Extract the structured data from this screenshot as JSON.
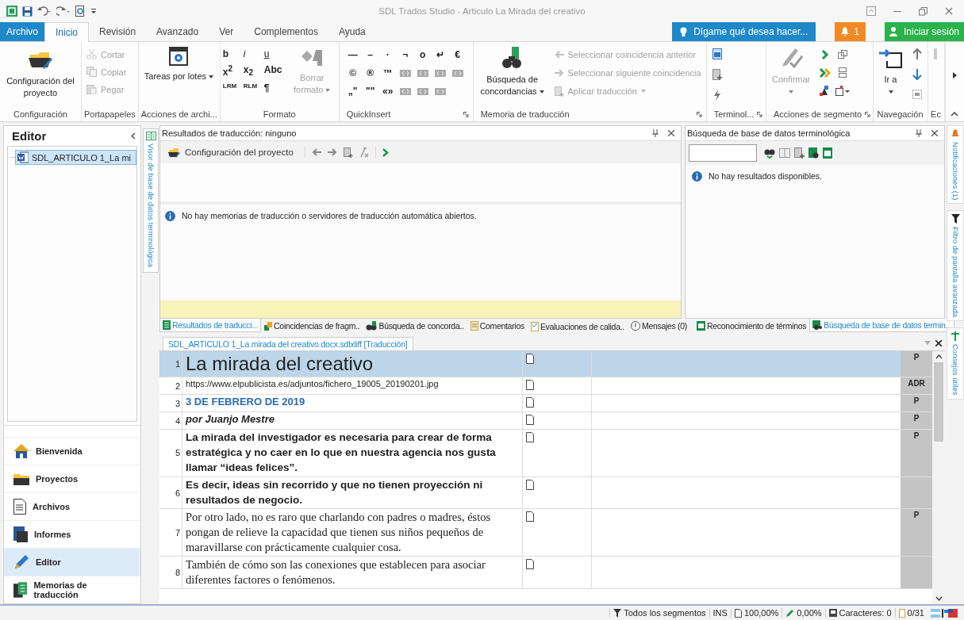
{
  "title_bar": {
    "title": "SDL Trados Studio - Articulo La Mirada del creativo"
  },
  "ribbon_tabs": [
    {
      "label": "Archivo",
      "kind": "file",
      "selected": false
    },
    {
      "label": "Inicio",
      "kind": "tab",
      "selected": true
    },
    {
      "label": "Revisión",
      "kind": "tab",
      "selected": false
    },
    {
      "label": "Avanzado",
      "kind": "tab",
      "selected": false
    },
    {
      "label": "Ver",
      "kind": "tab",
      "selected": false
    },
    {
      "label": "Complementos",
      "kind": "tab",
      "selected": false
    },
    {
      "label": "Ayuda",
      "kind": "tab",
      "selected": false
    }
  ],
  "tell_me": "Dígame qué desea hacer...",
  "alerts_count": "1",
  "sign_in": "Iniciar sesión",
  "ribbon_groups": [
    {
      "kind": "config",
      "name": "Configuración",
      "items": [
        {
          "label": "Configuración del proyecto",
          "disabled": false
        }
      ]
    },
    {
      "kind": "clipboard",
      "name": "Portapapeles",
      "items": [
        {
          "label": "Cortar",
          "disabled": true
        },
        {
          "label": "Copiar",
          "disabled": true
        },
        {
          "label": "Pegar",
          "disabled": true
        }
      ]
    },
    {
      "kind": "batch",
      "name": "Acciones de archi...",
      "items": [
        {
          "label": "Tareas por lotes",
          "disabled": false,
          "dropdown": true
        }
      ]
    },
    {
      "kind": "format",
      "name": "Formato",
      "glyphs": [
        "b",
        "i",
        "u",
        "x$^{2}$",
        "x$_{2}$",
        "Abc",
        "LRM",
        "RLM",
        "¶"
      ],
      "items": [
        {
          "label": "Borrar formato",
          "disabled": true,
          "dropdown": true
        }
      ]
    },
    {
      "kind": "quickinsert",
      "name": "QuickInsert",
      "rows": [
        [
          {
            "kind": "char",
            "text": "—"
          },
          {
            "kind": "char",
            "text": "–"
          },
          {
            "kind": "char",
            "text": "·"
          },
          {
            "kind": "char",
            "text": "¬"
          },
          {
            "kind": "char",
            "text": "o"
          },
          {
            "kind": "char",
            "text": "↵"
          },
          {
            "kind": "char",
            "text": "€"
          }
        ],
        [
          {
            "kind": "char",
            "text": "©"
          },
          {
            "kind": "char",
            "text": "®"
          },
          {
            "kind": "char",
            "text": "™"
          },
          {
            "kind": "tag"
          },
          {
            "kind": "tag"
          },
          {
            "kind": "tag"
          },
          {
            "kind": "tag"
          }
        ],
        [
          {
            "kind": "char",
            "text": "„\""
          },
          {
            "kind": "char",
            "text": "\"\""
          },
          {
            "kind": "char",
            "text": "«»"
          },
          {
            "kind": "tag"
          },
          {
            "kind": "tag"
          },
          {
            "kind": "tag"
          }
        ]
      ]
    },
    {
      "kind": "tm",
      "name": "Memoria de traducción",
      "items": [
        {
          "label": "Búsqueda de concordancias",
          "disabled": false,
          "dropdown": true
        },
        {
          "label": "Seleccionar coincidencia anterior",
          "disabled": true
        },
        {
          "label": "Seleccionar siguiente coincidencia",
          "disabled": true
        },
        {
          "label": "Aplicar traducción",
          "disabled": true,
          "dropdown": true
        }
      ]
    },
    {
      "kind": "termbase",
      "name": "Terminol..."
    },
    {
      "kind": "segment",
      "name": "Acciones de segmento",
      "items": [
        {
          "label": "Confirmar",
          "disabled": true,
          "dropdown": true
        }
      ]
    },
    {
      "kind": "nav",
      "name": "Navegación",
      "items": [
        {
          "label": "Ir a",
          "disabled": false,
          "dropdown": true
        }
      ]
    },
    {
      "kind": "cut",
      "name": "Ec"
    }
  ],
  "editor_panel": {
    "title": "Editor",
    "tree": [
      {
        "label": "SDL_ARTICULO 1_La mi",
        "selected": true
      }
    ]
  },
  "nav_items": [
    {
      "label": "Bienvenida",
      "selected": false
    },
    {
      "label": "Proyectos",
      "selected": false
    },
    {
      "label": "Archivos",
      "selected": false
    },
    {
      "label": "Informes",
      "selected": false
    },
    {
      "label": "Editor",
      "selected": true
    },
    {
      "label": "Memorias de traducción",
      "selected": false
    }
  ],
  "termbase_viewer_tab": "Visor de base de datos terminológica",
  "results_panel": {
    "title": "Resultados de traducción: ninguno",
    "toolbar_label": "Configuración del proyecto",
    "message": "No hay memorias de traducción o servidores de traducción automática abiertos."
  },
  "termbase_panel": {
    "title": "Búsqueda de base de datos terminológica",
    "message": "No hay resultados disponibles."
  },
  "bottom_tabs": [
    {
      "label": "Resultados de traducci...",
      "selected": true
    },
    {
      "label": "Coincidencias de fragm..",
      "selected": false
    },
    {
      "label": "Búsqueda de concorda..",
      "selected": false
    },
    {
      "label": "Comentarios",
      "selected": false
    },
    {
      "label": "Evaluaciones de calida..",
      "selected": false
    },
    {
      "label": "Mensajes (0)",
      "selected": false
    }
  ],
  "termbase_tabs": [
    {
      "label": "Reconocimiento de términos",
      "selected": false
    },
    {
      "label": "Búsqueda de base de datos termin...",
      "selected": true
    }
  ],
  "side_tabs": [
    "Notificaciones (1)",
    "Filtro de pantalla avanzada",
    "Consejos útiles"
  ],
  "document_tab": "SDL_ARTICULO 1_La mirada del creativo.docx.sdlxliff [Traducción]",
  "segments": [
    {
      "number": "1",
      "source": "La mirada del creativo",
      "kind": "heading",
      "status": "P",
      "selected": true
    },
    {
      "number": "2",
      "source": "https://www.elpublicista.es/adjuntos/fichero_19005_20190201.jpg",
      "kind": "plain",
      "status": "ADR",
      "selected": false
    },
    {
      "number": "3",
      "source": "3 DE FEBRERO DE 2019",
      "kind": "date",
      "status": "P",
      "selected": false
    },
    {
      "number": "4",
      "source": "por Juanjo Mestre",
      "kind": "byline",
      "status": "P",
      "selected": false
    },
    {
      "number": "5",
      "source": "La mirada del investigador es necesaria para crear de forma estratégica y no caer en lo que en nuestra agencia nos gusta llamar “ideas felices”.",
      "kind": "bold",
      "status": "P",
      "selected": false
    },
    {
      "number": "6",
      "source": "Es decir, ideas sin recorrido y que no tienen proyección ni resultados de negocio.",
      "kind": "bold",
      "selected": false
    },
    {
      "number": "7",
      "source": "Por otro lado, no es raro que charlando con padres o madres, éstos pongan de relieve la capacidad que tienen sus niños pequeños de maravillarse con prácticamente cualquier cosa.",
      "kind": "serif",
      "status": "P",
      "selected": false
    },
    {
      "number": "8",
      "source": "También de cómo son las conexiones que establecen para asociar diferentes factores o fenómenos.",
      "kind": "serif",
      "selected": false
    }
  ],
  "status_bar": {
    "filter": "Todos los segmentos",
    "mode": "INS",
    "match": "100,00%",
    "edited": "0,00%",
    "characters": "Caracteres: 0",
    "progress": "0/31"
  }
}
